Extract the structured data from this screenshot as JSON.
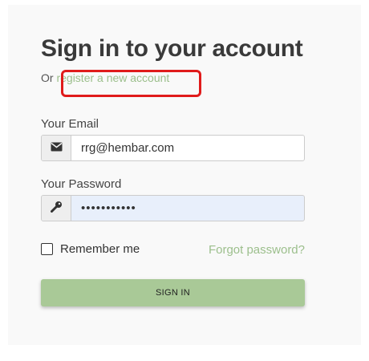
{
  "title": "Sign in to your account",
  "subline": {
    "or_text": "Or ",
    "register_link": "register a new account"
  },
  "email": {
    "label": "Your Email",
    "value": "rrg@hembar.com",
    "icon": "envelope-icon"
  },
  "password": {
    "label": "Your Password",
    "value": "•••••••••••",
    "icon": "key-icon"
  },
  "remember": {
    "label": "Remember me",
    "checked": false
  },
  "forgot_link": "Forgot password?",
  "signin_button": "SIGN IN",
  "colors": {
    "link": "#9cbf8c",
    "button": "#a9c997",
    "highlight": "#e01b1b",
    "password_bg": "#e8effb"
  }
}
